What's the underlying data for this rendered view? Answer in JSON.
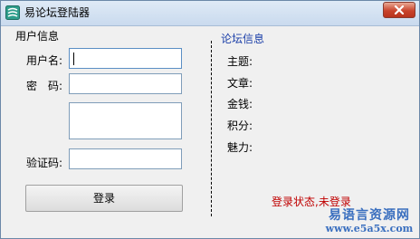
{
  "window": {
    "title": "易论坛登陆器",
    "close_icon": "close-x-icon"
  },
  "user_group": {
    "label": "用户信息",
    "username_label": "用户名:",
    "username_value": "",
    "password_label": "密　码:",
    "password_value": "",
    "captcha_label": "验证码:",
    "captcha_value": "",
    "login_button": "登录"
  },
  "forum_group": {
    "label": "论坛信息",
    "fields": [
      "主题:",
      "文章:",
      "金钱:",
      "积分:",
      "魅力:"
    ]
  },
  "status": {
    "text": "登录状态,未登录"
  },
  "watermark": {
    "name": "易语言资源网",
    "url": "www.e5a5x.com"
  },
  "colors": {
    "accent_blue": "#1a3ea8",
    "status_red": "#c00000",
    "watermark_blue": "#3a6fbf"
  }
}
